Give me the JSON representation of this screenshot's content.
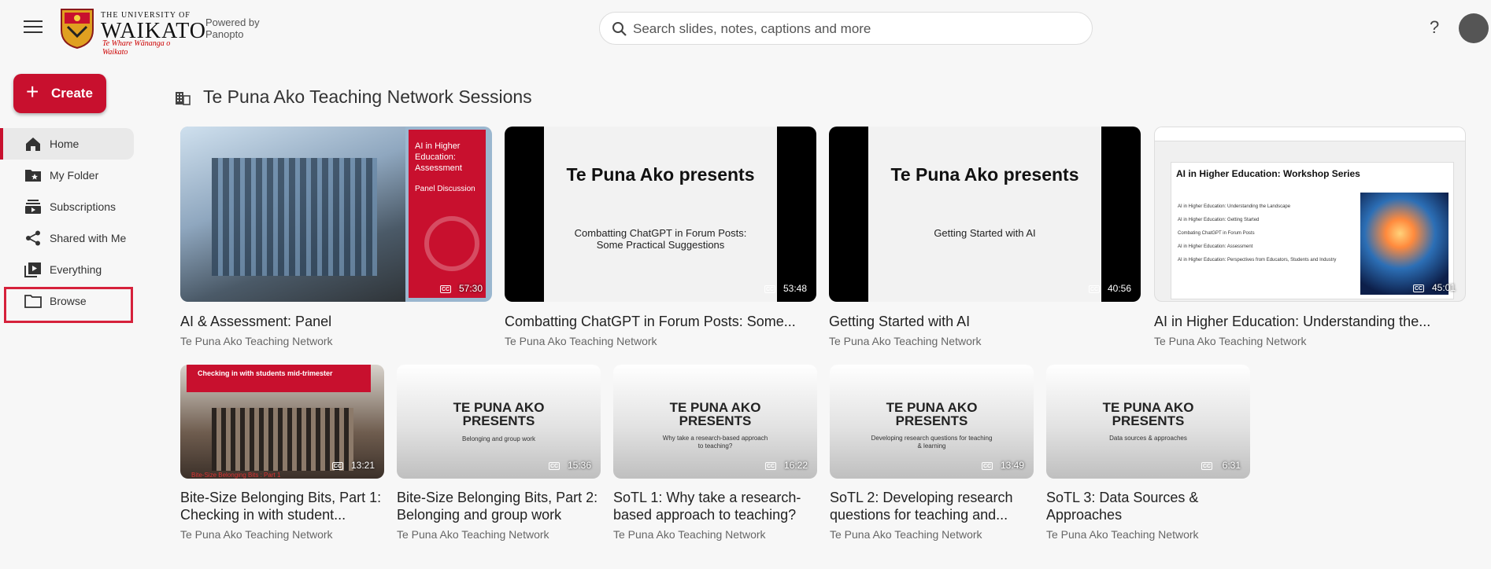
{
  "header": {
    "menu_icon": "hamburger-icon",
    "logo_small": "THE UNIVERSITY OF",
    "logo_big": "WAIKATO",
    "logo_maori": "Te Whare Wānanga o Waikato",
    "powered_line1": "Powered by",
    "powered_line2": "Panopto",
    "search_placeholder": "Search slides, notes, captions and more",
    "help_label": "?"
  },
  "sidebar": {
    "create_label": "Create",
    "items": [
      {
        "label": "Home",
        "icon": "home-icon"
      },
      {
        "label": "My Folder",
        "icon": "folder-star-icon"
      },
      {
        "label": "Subscriptions",
        "icon": "subscriptions-icon"
      },
      {
        "label": "Shared with Me",
        "icon": "share-icon"
      },
      {
        "label": "Everything",
        "icon": "play-library-icon"
      },
      {
        "label": "Browse",
        "icon": "folder-icon"
      }
    ]
  },
  "main": {
    "title": "Te Puna Ako Teaching Network Sessions",
    "videos": [
      {
        "title": "AI & Assessment: Panel",
        "folder": "Te Puna Ako Teaching Network",
        "duration": "57:30",
        "thumb_lines": [
          "AI in Higher Education: Assessment",
          "Panel Discussion"
        ]
      },
      {
        "title": "Combatting ChatGPT in Forum Posts: Some...",
        "folder": "Te Puna Ako Teaching Network",
        "duration": "53:48",
        "thumb_lines": [
          "Te Puna Ako presents",
          "Combatting ChatGPT in Forum Posts: Some Practical Suggestions"
        ]
      },
      {
        "title": "Getting Started with AI",
        "folder": "Te Puna Ako Teaching Network",
        "duration": "40:56",
        "thumb_lines": [
          "Te Puna Ako presents",
          "Getting Started with AI"
        ]
      },
      {
        "title": "AI in Higher Education: Understanding the...",
        "folder": "Te Puna Ako Teaching Network",
        "duration": "45:01",
        "thumb_lines": [
          "AI in Higher Education: Workshop Series",
          "AI in Higher Education: Understanding the Landscape",
          "AI in Higher Education: Getting Started",
          "Combating ChatGPT in Forum Posts",
          "AI in Higher Education: Assessment",
          "AI in Higher Education: Perspectives from Educators, Students and Industry"
        ]
      },
      {
        "title": "Bite-Size Belonging Bits, Part 1: Checking in with student...",
        "folder": "Te Puna Ako Teaching Network",
        "duration": "13:21",
        "thumb_lines": [
          "Checking in with students mid-trimester",
          "Bite-Size Belonging Bits : Part 1"
        ]
      },
      {
        "title": "Bite-Size Belonging Bits, Part 2: Belonging and group work",
        "folder": "Te Puna Ako Teaching Network",
        "duration": "15:36",
        "thumb_lines": [
          "TE PUNA AKO PRESENTS",
          "Belonging and group work"
        ]
      },
      {
        "title": "SoTL 1: Why take a research-based approach to teaching?",
        "folder": "Te Puna Ako Teaching Network",
        "duration": "16:22",
        "thumb_lines": [
          "TE PUNA AKO PRESENTS",
          "Why take a research-based approach to teaching?"
        ]
      },
      {
        "title": "SoTL 2: Developing research questions for teaching and...",
        "folder": "Te Puna Ako Teaching Network",
        "duration": "13:49",
        "thumb_lines": [
          "TE PUNA AKO PRESENTS",
          "Developing research questions for teaching & learning"
        ]
      },
      {
        "title": "SoTL 3: Data Sources & Approaches",
        "folder": "Te Puna Ako Teaching Network",
        "duration": "6:31",
        "thumb_lines": [
          "TE PUNA AKO PRESENTS",
          "Data sources & approaches"
        ]
      }
    ]
  },
  "colors": {
    "brand_red": "#c8102e",
    "highlight_box": "#d6213b"
  }
}
